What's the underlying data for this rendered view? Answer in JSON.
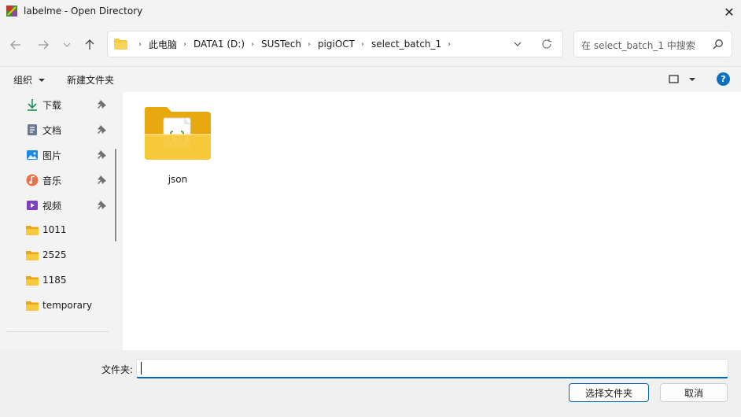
{
  "window": {
    "title": "labelme - Open Directory",
    "close_glyph": "✕"
  },
  "nav": {
    "back_icon": "arrow-left-icon",
    "forward_icon": "arrow-right-icon",
    "recent_icon": "chevron-down-icon",
    "up_icon": "arrow-up-icon"
  },
  "address": {
    "crumbs": [
      "此电脑",
      "DATA1 (D:)",
      "SUSTech",
      "pigiOCT",
      "select_batch_1"
    ],
    "separator": "›"
  },
  "search": {
    "placeholder": "在 select_batch_1 中搜索"
  },
  "command_bar": {
    "organize_label": "组织",
    "new_folder_label": "新建文件夹",
    "help_glyph": "?"
  },
  "sidebar": {
    "quick_access": [
      {
        "label": "下载",
        "icon": "download-icon",
        "pinned": true
      },
      {
        "label": "文档",
        "icon": "document-icon",
        "pinned": true
      },
      {
        "label": "图片",
        "icon": "pictures-icon",
        "pinned": true
      },
      {
        "label": "音乐",
        "icon": "music-icon",
        "pinned": true
      },
      {
        "label": "视频",
        "icon": "videos-icon",
        "pinned": true
      }
    ],
    "folders": [
      {
        "label": "1011",
        "icon": "folder-icon"
      },
      {
        "label": "2525",
        "icon": "folder-icon"
      },
      {
        "label": "1185",
        "icon": "folder-icon"
      },
      {
        "label": "temporary",
        "icon": "folder-icon"
      }
    ]
  },
  "content": {
    "items": [
      {
        "name": "json",
        "type": "folder"
      }
    ]
  },
  "bottom": {
    "folder_label": "文件夹:",
    "folder_value": "",
    "select_button": "选择文件夹",
    "cancel_button": "取消"
  },
  "colors": {
    "accent": "#0067c0",
    "folder_yellow": "#f8c93d",
    "folder_dark": "#e8a810"
  }
}
